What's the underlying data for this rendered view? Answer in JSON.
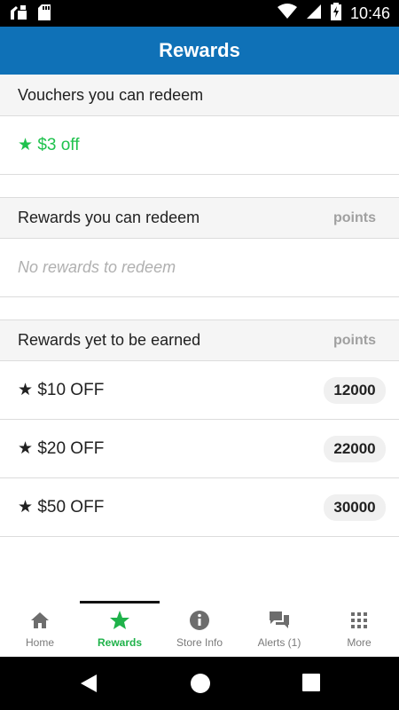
{
  "status_bar": {
    "time": "10:46",
    "icons": [
      "notification-icon",
      "sd-card-icon",
      "wifi-icon",
      "signal-icon",
      "battery-charging-icon"
    ]
  },
  "app_bar": {
    "title": "Rewards"
  },
  "vouchers": {
    "title": "Vouchers you can redeem",
    "items": [
      {
        "star": "★",
        "label": "$3 off"
      }
    ]
  },
  "redeemable": {
    "title": "Rewards you can redeem",
    "points_label": "points",
    "empty_text": "No rewards to redeem"
  },
  "unearned": {
    "title": "Rewards yet to be earned",
    "points_label": "points",
    "items": [
      {
        "star": "★",
        "label": "$10 OFF",
        "points": "12000"
      },
      {
        "star": "★",
        "label": "$20 OFF",
        "points": "22000"
      },
      {
        "star": "★",
        "label": "$50 OFF",
        "points": "30000"
      }
    ]
  },
  "bottom_nav": {
    "items": [
      {
        "label": "Home",
        "icon": "home-icon"
      },
      {
        "label": "Rewards",
        "icon": "star-icon",
        "active": true
      },
      {
        "label": "Store Info",
        "icon": "info-icon"
      },
      {
        "label": "Alerts (1)",
        "icon": "chat-icon"
      },
      {
        "label": "More",
        "icon": "grid-icon"
      }
    ]
  },
  "colors": {
    "app_bar": "#0f71b7",
    "accent_green": "#1fc24d",
    "header_bg": "#f5f5f5",
    "muted": "#a0a0a0"
  }
}
